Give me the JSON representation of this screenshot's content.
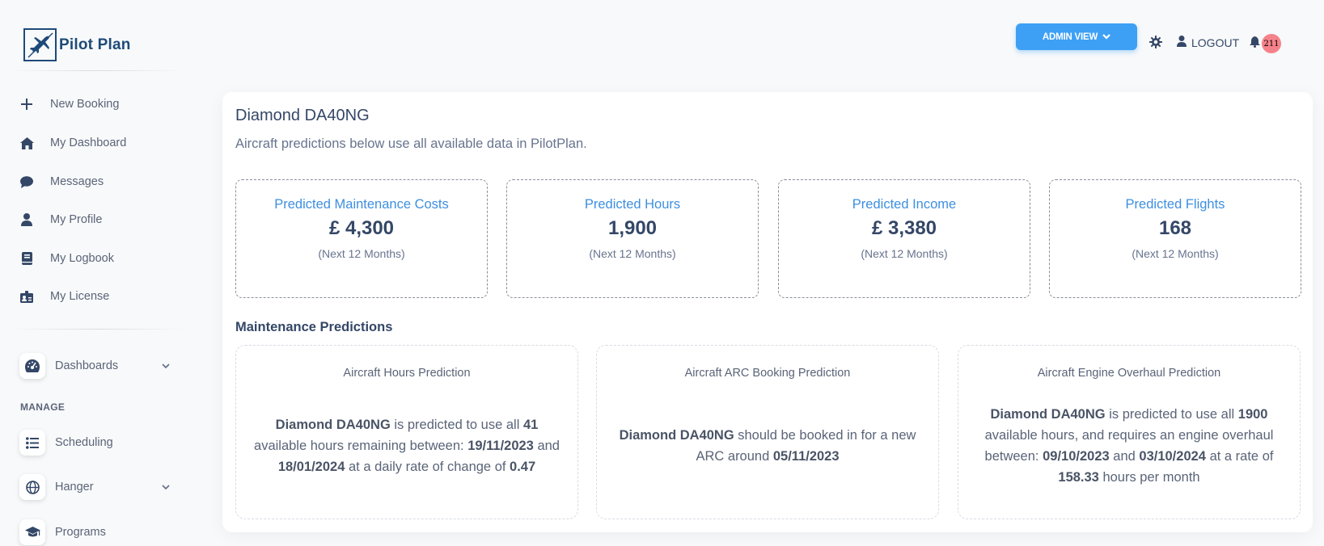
{
  "app": {
    "name": "Pilot Plan"
  },
  "sidebar": {
    "items": [
      {
        "label": "New Booking",
        "icon": "plus-icon"
      },
      {
        "label": "My Dashboard",
        "icon": "home-icon"
      },
      {
        "label": "Messages",
        "icon": "chat-icon"
      },
      {
        "label": "My Profile",
        "icon": "user-icon"
      },
      {
        "label": "My Logbook",
        "icon": "book-icon"
      },
      {
        "label": "My License",
        "icon": "id-card-icon"
      }
    ],
    "dashboards": "Dashboards",
    "manage_label": "MANAGE",
    "scheduling": "Scheduling",
    "hanger": "Hanger",
    "programs": "Programs"
  },
  "topbar": {
    "admin_view": "ADMIN VIEW",
    "logout": "LOGOUT",
    "notification_count": "211"
  },
  "main": {
    "title": "Diamond DA40NG",
    "subtitle": "Aircraft predictions below use all available data in PilotPlan.",
    "stats": [
      {
        "label": "Predicted Maintenance Costs",
        "value": "£ 4,300",
        "period": "(Next 12 Months)"
      },
      {
        "label": "Predicted Hours",
        "value": "1,900",
        "period": "(Next 12 Months)"
      },
      {
        "label": "Predicted Income",
        "value": "£ 3,380",
        "period": "(Next 12 Months)"
      },
      {
        "label": "Predicted Flights",
        "value": "168",
        "period": "(Next 12 Months)"
      }
    ],
    "maintenance_title": "Maintenance Predictions",
    "predictions": [
      {
        "title": "Aircraft Hours Prediction",
        "aircraft": "Diamond DA40NG",
        "t1": " is predicted to use all ",
        "hours": "41",
        "t2": " available hours remaining between: ",
        "date1": "19/11/2023",
        "t3": " and ",
        "date2": "18/01/2024",
        "t4": " at a daily rate of change of ",
        "rate": "0.47"
      },
      {
        "title": "Aircraft ARC Booking Prediction",
        "aircraft": "Diamond DA40NG",
        "t1": " should be booked in for a new ARC around ",
        "date1": "05/11/2023"
      },
      {
        "title": "Aircraft Engine Overhaul Prediction",
        "aircraft": "Diamond DA40NG",
        "t1": " is predicted to use all ",
        "hours": "1900",
        "t2": " available hours, and requires an engine overhaul between: ",
        "date1": "09/10/2023",
        "t3": " and ",
        "date2": "03/10/2024",
        "t4": " at a rate of ",
        "rate": "158.33",
        "t5": " hours per month"
      }
    ]
  }
}
